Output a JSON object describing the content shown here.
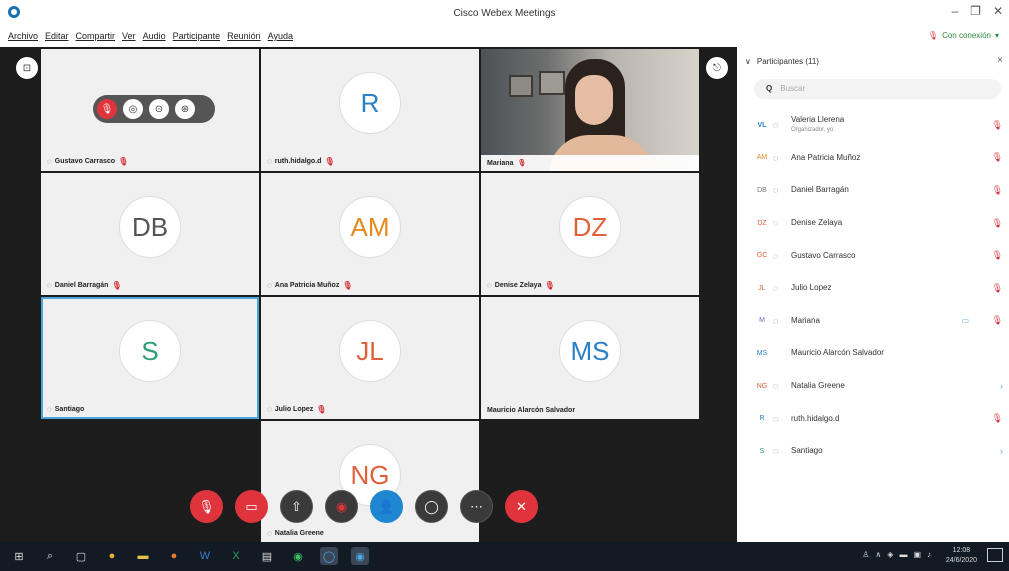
{
  "window": {
    "title": "Cisco Webex Meetings",
    "min": "–",
    "max": "❐",
    "close": "✕"
  },
  "menu": [
    "Archivo",
    "Editar",
    "Compartir",
    "Ver",
    "Audio",
    "Participante",
    "Reunión",
    "Ayuda"
  ],
  "connection": {
    "label": "Con conexión",
    "caret": "▾"
  },
  "tiles": [
    {
      "initials": "",
      "name": "Gustavo Carrasco",
      "color": "#777777"
    },
    {
      "initials": "R",
      "name": "ruth.hidalgo.d",
      "color": "#2a7fc7"
    },
    {
      "initials": "",
      "name": "Mariana",
      "color": "#777777"
    },
    {
      "initials": "DB",
      "name": "Daniel Barragán",
      "color": "#555555"
    },
    {
      "initials": "AM",
      "name": "Ana Patricia Muñoz",
      "color": "#e68a1f"
    },
    {
      "initials": "DZ",
      "name": "Denise Zelaya",
      "color": "#e0603a"
    },
    {
      "initials": "S",
      "name": "Santiago",
      "color": "#2e9e7a"
    },
    {
      "initials": "JL",
      "name": "Julio Lopez",
      "color": "#e0603a"
    },
    {
      "initials": "MS",
      "name": "Mauricio Alarcón Salvador",
      "color": "#2a7fc7"
    },
    {
      "initials": "NG",
      "name": "Natalia Greene",
      "color": "#e0603a"
    }
  ],
  "panel": {
    "title": "Participantes (11)",
    "search_placeholder": "Buscar",
    "participants": [
      {
        "initials": "VL",
        "name": "Valeria Llerena",
        "role": "Organizador, yo",
        "color": "#2a7fc7"
      },
      {
        "initials": "AM",
        "name": "Ana Patricia Muñoz",
        "role": "",
        "color": "#e68a1f"
      },
      {
        "initials": "DB",
        "name": "Daniel Barragán",
        "role": "",
        "color": "#777777"
      },
      {
        "initials": "DZ",
        "name": "Denise Zelaya",
        "role": "",
        "color": "#e0603a"
      },
      {
        "initials": "GC",
        "name": "Gustavo Carrasco",
        "role": "",
        "color": "#e0603a"
      },
      {
        "initials": "JL",
        "name": "Julio Lopez",
        "role": "",
        "color": "#e0603a"
      },
      {
        "initials": "M",
        "name": "Mariana",
        "role": "",
        "color": "#8a5fb3"
      },
      {
        "initials": "MS",
        "name": "Mauricio Alarcón Salvador",
        "role": "",
        "color": "#2a7fc7"
      },
      {
        "initials": "NG",
        "name": "Natalia Greene",
        "role": "",
        "color": "#e0603a"
      },
      {
        "initials": "R",
        "name": "ruth.hidalgo.d",
        "role": "",
        "color": "#2a7fc7"
      },
      {
        "initials": "S",
        "name": "Santiago",
        "role": "",
        "color": "#2e9e7a"
      }
    ]
  },
  "taskbar": {
    "time": "12:08",
    "date": "24/6/2020"
  }
}
